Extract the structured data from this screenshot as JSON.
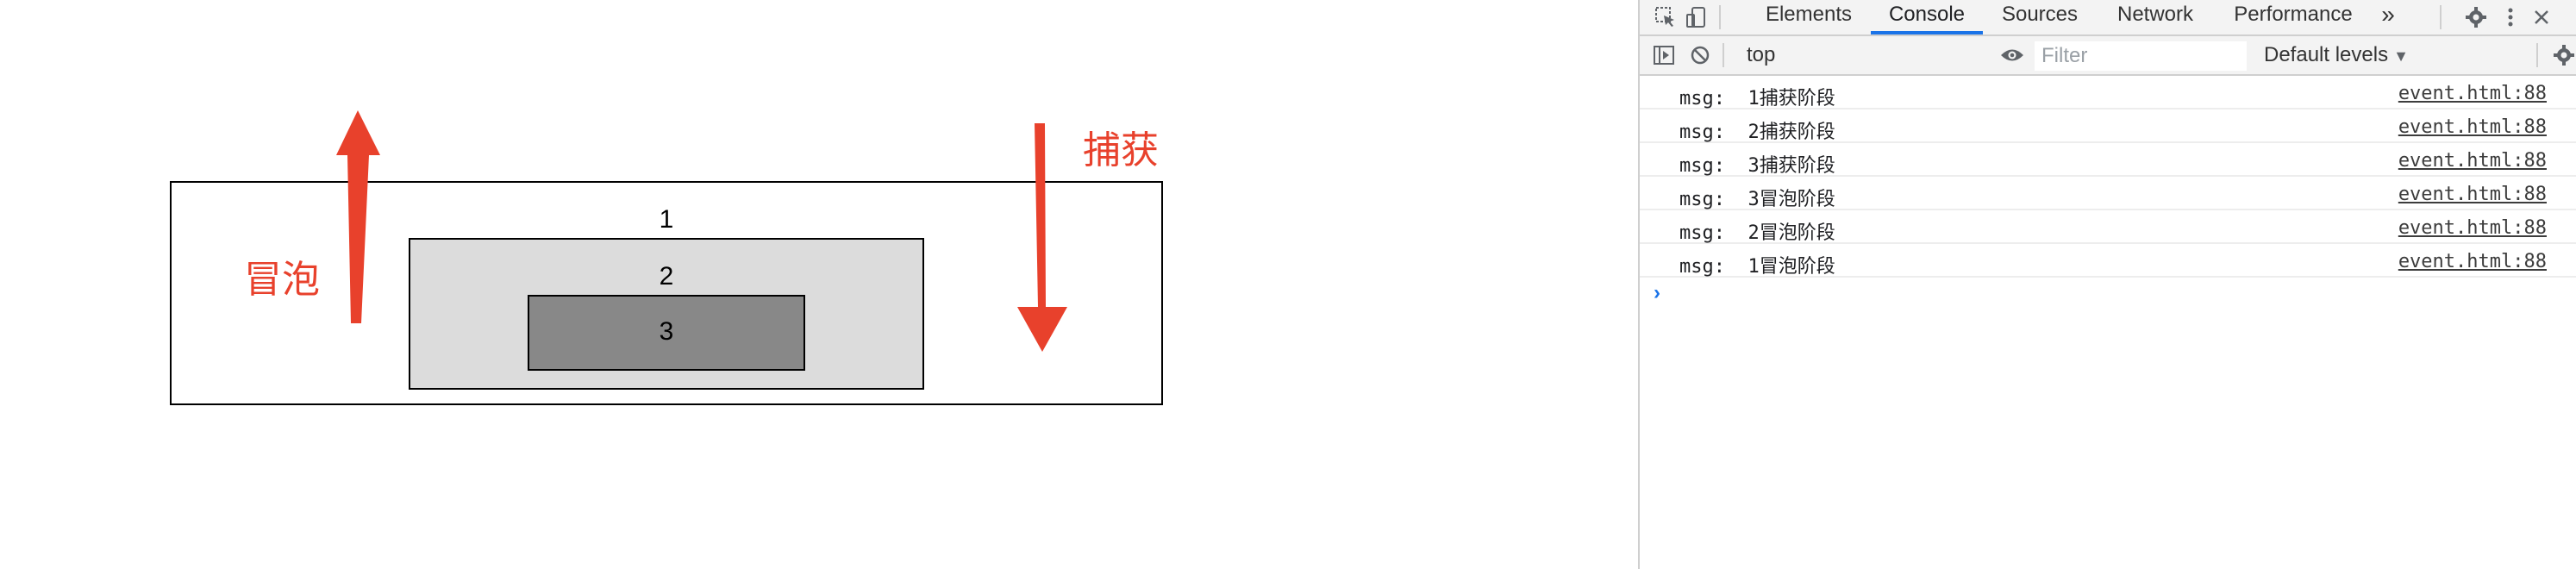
{
  "demo": {
    "box1_label": "1",
    "box2_label": "2",
    "box3_label": "3",
    "bubble_text": "冒泡",
    "capture_text": "捕获",
    "arrow_color": "#e8412c",
    "box2_color": "#dcdcdc",
    "box3_color": "#888888"
  },
  "devtools": {
    "tabs": [
      {
        "label": "Elements",
        "active": false
      },
      {
        "label": "Console",
        "active": true
      },
      {
        "label": "Sources",
        "active": false
      },
      {
        "label": "Network",
        "active": false
      },
      {
        "label": "Performance",
        "active": false
      }
    ],
    "more_tabs": "»",
    "icons": {
      "inspect": "inspect-element-icon",
      "device": "device-toolbar-icon",
      "settings": "gear-icon",
      "menu": "kebab-menu-icon",
      "close": "close-icon",
      "sidebar": "show-sidebar-icon",
      "clear": "clear-console-icon",
      "eye": "live-expression-eye-icon",
      "console_settings": "console-settings-gear-icon"
    },
    "toolbar": {
      "context": "top",
      "filter_placeholder": "Filter",
      "levels": "Default levels"
    },
    "accent_color": "#1a73e8",
    "logs": [
      {
        "prefix": "msg:",
        "text": "1捕获阶段",
        "source": "event.html:88"
      },
      {
        "prefix": "msg:",
        "text": "2捕获阶段",
        "source": "event.html:88"
      },
      {
        "prefix": "msg:",
        "text": "3捕获阶段",
        "source": "event.html:88"
      },
      {
        "prefix": "msg:",
        "text": "3冒泡阶段",
        "source": "event.html:88"
      },
      {
        "prefix": "msg:",
        "text": "2冒泡阶段",
        "source": "event.html:88"
      },
      {
        "prefix": "msg:",
        "text": "1冒泡阶段",
        "source": "event.html:88"
      }
    ],
    "prompt": "›"
  }
}
